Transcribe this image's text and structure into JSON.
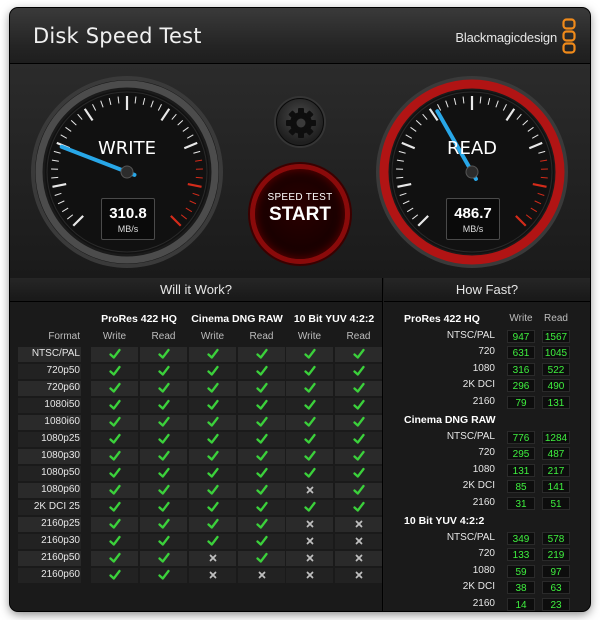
{
  "window": {
    "title": "Disk Speed Test",
    "brand": "Blackmagicdesign"
  },
  "gauges": {
    "write": {
      "label": "WRITE",
      "value": "310.8",
      "unit": "MB/s",
      "needle_fraction": 0.245,
      "accent": "#28a7e8"
    },
    "read": {
      "label": "READ",
      "value": "486.7",
      "unit": "MB/s",
      "needle_fraction": 0.39,
      "accent": "#28a7e8"
    }
  },
  "controls": {
    "settings_icon": "gear-icon",
    "start_small": "SPEED TEST",
    "start_big": "START"
  },
  "will_it_work": {
    "title": "Will it Work?",
    "format_header": "Format",
    "groups": [
      "ProRes 422 HQ",
      "Cinema DNG RAW",
      "10 Bit YUV 4:2:2"
    ],
    "subheaders": [
      "Write",
      "Read"
    ],
    "rows": [
      {
        "format": "NTSC/PAL",
        "cells": [
          true,
          true,
          true,
          true,
          true,
          true
        ]
      },
      {
        "format": "720p50",
        "cells": [
          true,
          true,
          true,
          true,
          true,
          true
        ]
      },
      {
        "format": "720p60",
        "cells": [
          true,
          true,
          true,
          true,
          true,
          true
        ]
      },
      {
        "format": "1080i50",
        "cells": [
          true,
          true,
          true,
          true,
          true,
          true
        ]
      },
      {
        "format": "1080i60",
        "cells": [
          true,
          true,
          true,
          true,
          true,
          true
        ]
      },
      {
        "format": "1080p25",
        "cells": [
          true,
          true,
          true,
          true,
          true,
          true
        ]
      },
      {
        "format": "1080p30",
        "cells": [
          true,
          true,
          true,
          true,
          true,
          true
        ]
      },
      {
        "format": "1080p50",
        "cells": [
          true,
          true,
          true,
          true,
          true,
          true
        ]
      },
      {
        "format": "1080p60",
        "cells": [
          true,
          true,
          true,
          true,
          false,
          true
        ]
      },
      {
        "format": "2K DCI 25",
        "cells": [
          true,
          true,
          true,
          true,
          true,
          true
        ]
      },
      {
        "format": "2160p25",
        "cells": [
          true,
          true,
          true,
          true,
          false,
          false
        ]
      },
      {
        "format": "2160p30",
        "cells": [
          true,
          true,
          true,
          true,
          false,
          false
        ]
      },
      {
        "format": "2160p50",
        "cells": [
          true,
          true,
          false,
          true,
          false,
          false
        ]
      },
      {
        "format": "2160p60",
        "cells": [
          true,
          true,
          false,
          false,
          false,
          false
        ]
      }
    ],
    "check_color": "#3bd13b",
    "cross_color": "#bfbfbf"
  },
  "how_fast": {
    "title": "How Fast?",
    "headers": [
      "Write",
      "Read"
    ],
    "groups": [
      {
        "name": "ProRes 422 HQ",
        "rows": [
          {
            "label": "NTSC/PAL",
            "write": "947",
            "read": "1567"
          },
          {
            "label": "720",
            "write": "631",
            "read": "1045"
          },
          {
            "label": "1080",
            "write": "316",
            "read": "522"
          },
          {
            "label": "2K DCI",
            "write": "296",
            "read": "490"
          },
          {
            "label": "2160",
            "write": "79",
            "read": "131"
          }
        ]
      },
      {
        "name": "Cinema DNG RAW",
        "rows": [
          {
            "label": "NTSC/PAL",
            "write": "776",
            "read": "1284"
          },
          {
            "label": "720",
            "write": "295",
            "read": "487"
          },
          {
            "label": "1080",
            "write": "131",
            "read": "217"
          },
          {
            "label": "2K DCI",
            "write": "85",
            "read": "141"
          },
          {
            "label": "2160",
            "write": "31",
            "read": "51"
          }
        ]
      },
      {
        "name": "10 Bit YUV 4:2:2",
        "rows": [
          {
            "label": "NTSC/PAL",
            "write": "349",
            "read": "578"
          },
          {
            "label": "720",
            "write": "133",
            "read": "219"
          },
          {
            "label": "1080",
            "write": "59",
            "read": "97"
          },
          {
            "label": "2K DCI",
            "write": "38",
            "read": "63"
          },
          {
            "label": "2160",
            "write": "14",
            "read": "23"
          }
        ]
      }
    ],
    "value_color": "#3ff03f"
  }
}
